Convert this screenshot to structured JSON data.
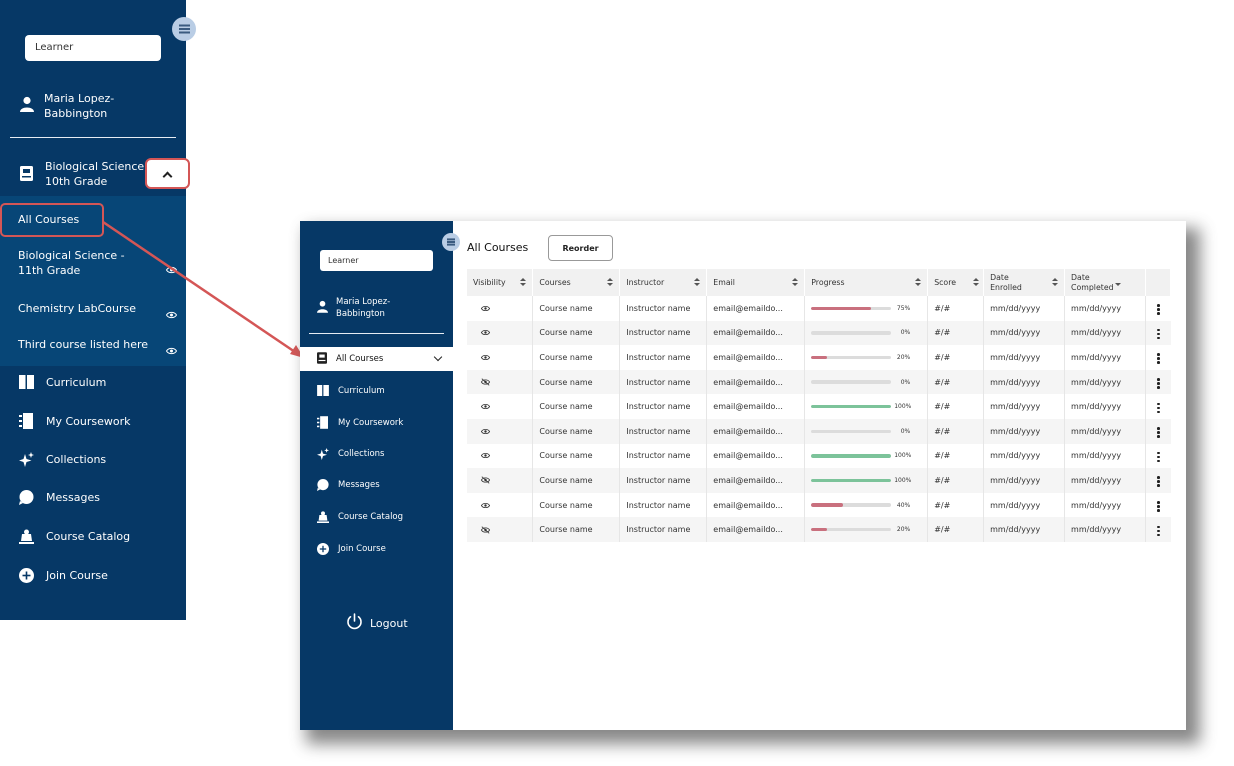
{
  "zoom": {
    "role_value": "Learner",
    "user_name_line1": "Maria Lopez-",
    "user_name_line2": "Babbington",
    "current_course_line1": "Biological Science -",
    "current_course_line2": "10th Grade",
    "sub_items": [
      {
        "label": "All Courses"
      },
      {
        "label_line1": "Biological Science -",
        "label_line2": "11th Grade"
      },
      {
        "label": "Chemistry LabCourse"
      },
      {
        "label": "Third course listed here"
      }
    ],
    "nav": [
      {
        "label": "Curriculum",
        "icon": "curriculum-icon"
      },
      {
        "label": "My Coursework",
        "icon": "coursework-icon"
      },
      {
        "label": "Collections",
        "icon": "sparkle-icon"
      },
      {
        "label": "Messages",
        "icon": "chat-icon"
      },
      {
        "label": "Course Catalog",
        "icon": "catalog-icon"
      },
      {
        "label": "Join Course",
        "icon": "plus-circle-icon"
      }
    ]
  },
  "sidebar": {
    "role_value": "Learner",
    "user_name_line1": "Maria Lopez-",
    "user_name_line2": "Babbington",
    "active_item": "All Courses",
    "nav": [
      {
        "label": "Curriculum"
      },
      {
        "label": "My Coursework"
      },
      {
        "label": "Collections"
      },
      {
        "label": "Messages"
      },
      {
        "label": "Course Catalog"
      },
      {
        "label": "Join Course"
      }
    ],
    "logout_label": "Logout"
  },
  "main": {
    "title": "All Courses",
    "reorder_label": "Reorder",
    "columns": [
      {
        "label": "Visibility",
        "sort": "both"
      },
      {
        "label": "Courses",
        "sort": "both"
      },
      {
        "label": "Instructor",
        "sort": "both"
      },
      {
        "label": "Email",
        "sort": "both"
      },
      {
        "label": "Progress",
        "sort": "both"
      },
      {
        "label": "Score",
        "sort": "both"
      },
      {
        "label_line1": "Date",
        "label_line2": "Enrolled",
        "sort": "both"
      },
      {
        "label_line1": "Date",
        "label_line2": "Completed",
        "sort": "down"
      }
    ],
    "rows": [
      {
        "visible": true,
        "course": "Course name",
        "instructor": "Instructor name",
        "email": "email@emaildo...",
        "progress": 75,
        "progress_label": "75%",
        "score": "#/#",
        "enrolled": "mm/dd/yyyy",
        "completed": "mm/dd/yyyy"
      },
      {
        "visible": true,
        "course": "Course name",
        "instructor": "Instructor name",
        "email": "email@emaildo...",
        "progress": 0,
        "progress_label": "0%",
        "score": "#/#",
        "enrolled": "mm/dd/yyyy",
        "completed": "mm/dd/yyyy"
      },
      {
        "visible": true,
        "course": "Course name",
        "instructor": "Instructor name",
        "email": "email@emaildo...",
        "progress": 20,
        "progress_label": "20%",
        "score": "#/#",
        "enrolled": "mm/dd/yyyy",
        "completed": "mm/dd/yyyy"
      },
      {
        "visible": false,
        "course": "Course name",
        "instructor": "Instructor name",
        "email": "email@emaildo...",
        "progress": 0,
        "progress_label": "0%",
        "score": "#/#",
        "enrolled": "mm/dd/yyyy",
        "completed": "mm/dd/yyyy"
      },
      {
        "visible": true,
        "course": "Course name",
        "instructor": "Instructor name",
        "email": "email@emaildo...",
        "progress": 100,
        "progress_label": "100%",
        "score": "#/#",
        "enrolled": "mm/dd/yyyy",
        "completed": "mm/dd/yyyy"
      },
      {
        "visible": true,
        "course": "Course name",
        "instructor": "Instructor name",
        "email": "email@emaildo...",
        "progress": 0,
        "progress_label": "0%",
        "score": "#/#",
        "enrolled": "mm/dd/yyyy",
        "completed": "mm/dd/yyyy"
      },
      {
        "visible": true,
        "course": "Course name",
        "instructor": "Instructor name",
        "email": "email@emaildo...",
        "progress": 100,
        "progress_label": "100%",
        "score": "#/#",
        "enrolled": "mm/dd/yyyy",
        "completed": "mm/dd/yyyy"
      },
      {
        "visible": false,
        "course": "Course name",
        "instructor": "Instructor name",
        "email": "email@emaildo...",
        "progress": 100,
        "progress_label": "100%",
        "score": "#/#",
        "enrolled": "mm/dd/yyyy",
        "completed": "mm/dd/yyyy"
      },
      {
        "visible": true,
        "course": "Course name",
        "instructor": "Instructor name",
        "email": "email@emaildo...",
        "progress": 40,
        "progress_label": "40%",
        "score": "#/#",
        "enrolled": "mm/dd/yyyy",
        "completed": "mm/dd/yyyy"
      },
      {
        "visible": false,
        "course": "Course name",
        "instructor": "Instructor name",
        "email": "email@emaildo...",
        "progress": 20,
        "progress_label": "20%",
        "score": "#/#",
        "enrolled": "mm/dd/yyyy",
        "completed": "mm/dd/yyyy"
      }
    ]
  },
  "colors": {
    "sidebar_bg": "#063866",
    "highlight_red": "#d45656",
    "progress_complete": "#7cc39a",
    "progress_partial": "#c9707e",
    "progress_track": "#dcdcdc"
  }
}
